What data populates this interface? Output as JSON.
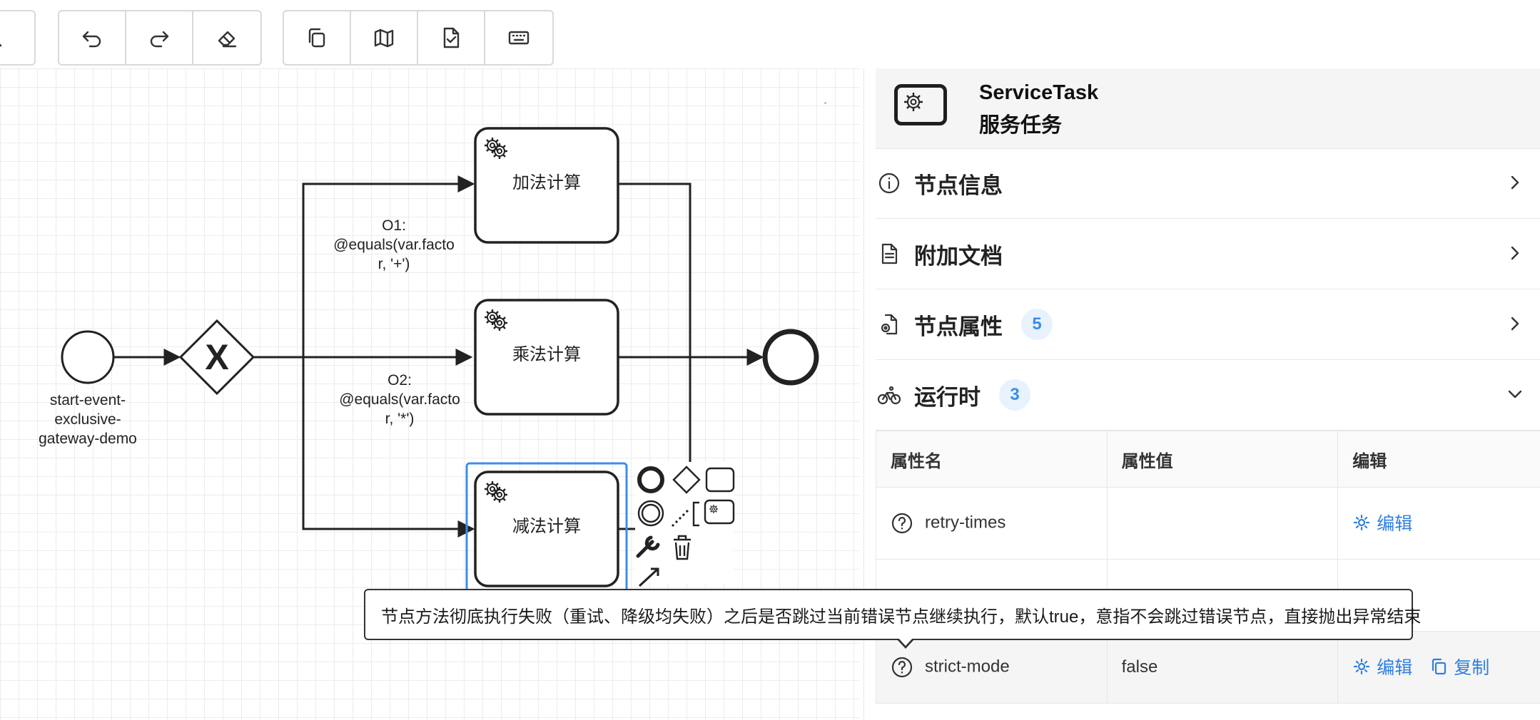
{
  "toolbar": {
    "groups": [
      [
        "zoom-out-icon"
      ],
      [
        "undo-icon",
        "redo-icon",
        "eraser-icon"
      ],
      [
        "copy-icon",
        "map-icon",
        "file-check-icon",
        "keyboard-icon"
      ]
    ]
  },
  "diagram": {
    "start_event_label": "start-event-\nexclusive-\ngateway-demo",
    "gateway_symbol": "X",
    "tasks": [
      {
        "label": "加法计算"
      },
      {
        "label": "乘法计算"
      },
      {
        "label": "减法计算"
      }
    ],
    "flows": [
      {
        "label": "O1:\n@equals(var.facto\nr, '+')"
      },
      {
        "label": "O2:\n@equals(var.facto\nr, '*')"
      }
    ]
  },
  "panel": {
    "header": {
      "title": "ServiceTask",
      "subtitle": "服务任务",
      "icon": "service-task-icon"
    },
    "sections": [
      {
        "label": "节点信息",
        "icon": "info-icon",
        "badge": null,
        "expanded": false
      },
      {
        "label": "附加文档",
        "icon": "document-icon",
        "badge": null,
        "expanded": false
      },
      {
        "label": "节点属性",
        "icon": "file-settings-icon",
        "badge": "5",
        "expanded": false
      },
      {
        "label": "运行时",
        "icon": "bike-icon",
        "badge": "3",
        "expanded": true
      }
    ],
    "table": {
      "headers": [
        "属性名",
        "属性值",
        "编辑"
      ],
      "rows": [
        {
          "name": "retry-times",
          "value": "",
          "actions": [
            "编辑"
          ]
        },
        {
          "name": "",
          "value": "",
          "actions": []
        },
        {
          "name": "strict-mode",
          "value": "false",
          "actions": [
            "编辑",
            "复制"
          ]
        }
      ]
    }
  },
  "tooltip": {
    "text": "节点方法彻底执行失败（重试、降级均失败）之后是否跳过当前错误节点继续执行，默认true，意指不会跳过错误节点，直接抛出异常结束"
  },
  "colors": {
    "accent": "#2f7fe0",
    "selection": "#3c8ee8",
    "badge_bg": "#e8f2fd"
  }
}
